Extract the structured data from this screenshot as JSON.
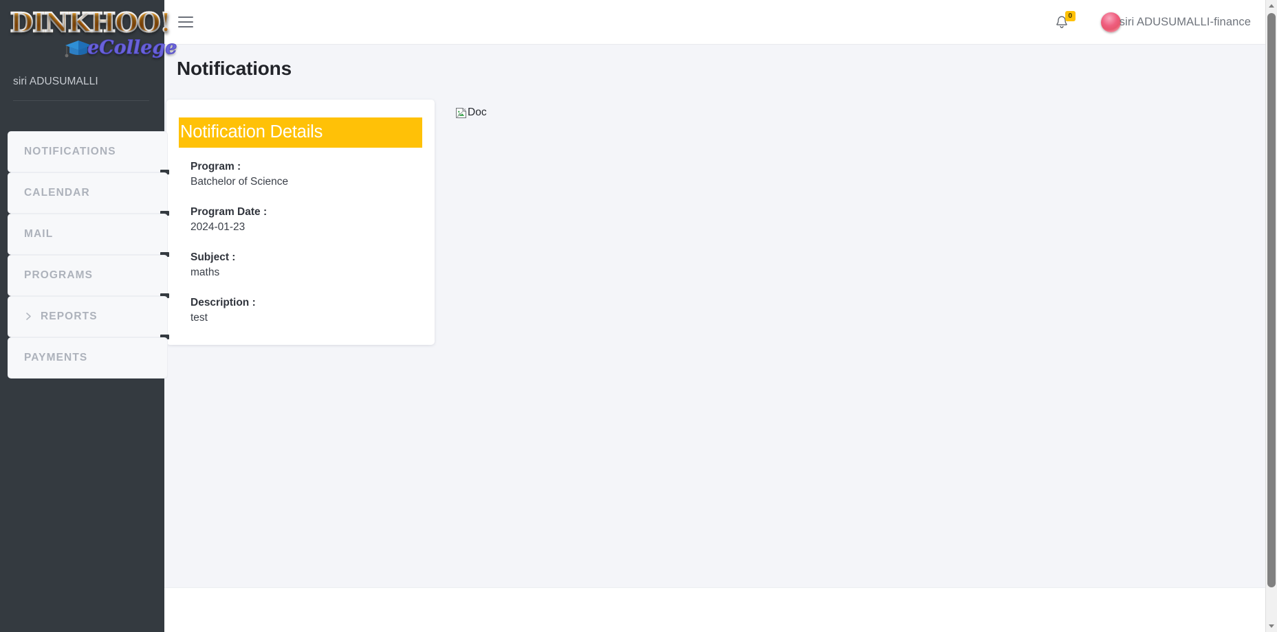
{
  "brand": {
    "logo_primary": "DINKHOO!",
    "logo_secondary": "eCollege",
    "cap_icon": "graduation-cap-icon",
    "user": "siri ADUSUMALLI"
  },
  "sidebar": {
    "items": [
      {
        "label": "NOTIFICATIONS",
        "icon": null,
        "expandable": false
      },
      {
        "label": "CALENDAR",
        "icon": null,
        "expandable": false
      },
      {
        "label": "MAIL",
        "icon": null,
        "expandable": false
      },
      {
        "label": "PROGRAMS",
        "icon": null,
        "expandable": false
      },
      {
        "label": "REPORTS",
        "icon": "chevron-right-icon",
        "expandable": true
      },
      {
        "label": "PAYMENTS",
        "icon": null,
        "expandable": false
      }
    ]
  },
  "topbar": {
    "menu_toggle": "hamburger-menu-icon",
    "notifications": {
      "icon": "bell-icon",
      "count": "0"
    },
    "user": {
      "avatar": "user-avatar",
      "name": "siri ADUSUMALLI-finance"
    }
  },
  "page": {
    "title": "Notifications"
  },
  "notification_details": {
    "header": "Notification Details",
    "fields": [
      {
        "label": "Program :",
        "value": "Batchelor of Science"
      },
      {
        "label": "Program Date :",
        "value": "2024-01-23"
      },
      {
        "label": "Subject :",
        "value": "maths"
      },
      {
        "label": "Description :",
        "value": "test"
      }
    ]
  },
  "attachment": {
    "alt_text": "Doc",
    "icon": "broken-image-icon"
  },
  "scrollbar": {
    "up_arrow": "scroll-up-icon",
    "down_arrow": "scroll-down-icon"
  },
  "colors": {
    "sidebar_bg": "#343a40",
    "page_bg": "#f4f5f9",
    "accent_yellow": "#ffc107",
    "nav_item_bg": "#f7f8fa",
    "nav_label": "#adb2bb",
    "logo_orange": "#f59a21",
    "logo_purple": "#6a63d8"
  }
}
